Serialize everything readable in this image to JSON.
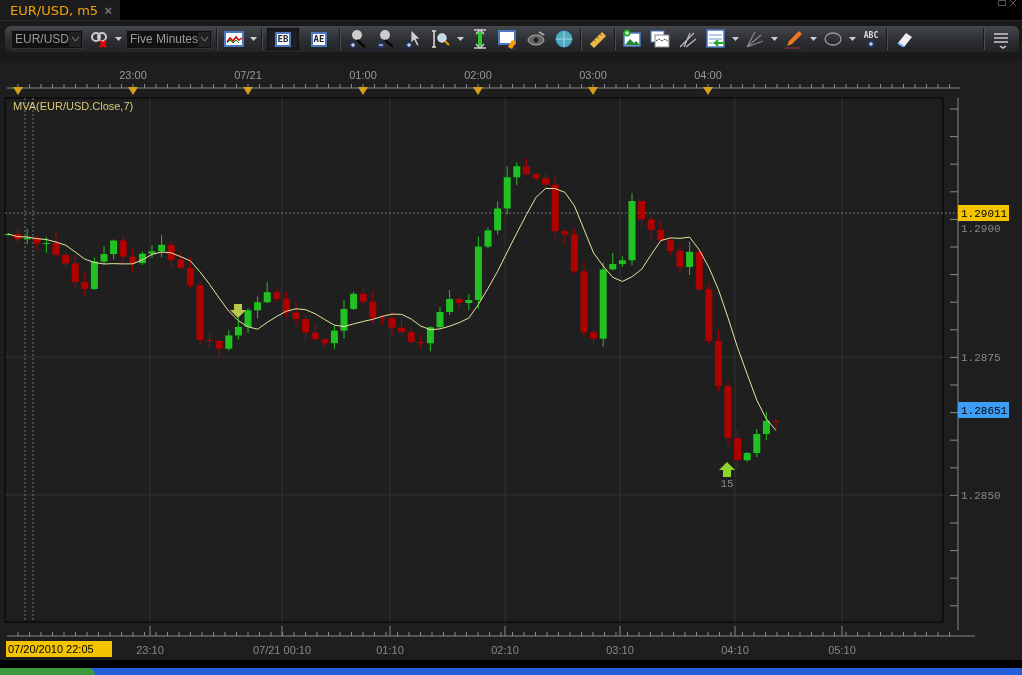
{
  "tab": {
    "title": "EUR/USD, m5",
    "close": "×",
    "active": true
  },
  "toolbar": {
    "symbol": "EUR/USD",
    "timeframe": "Five Minutes",
    "view_toggles": [
      {
        "label": "EB",
        "selected": true
      },
      {
        "label": "AE",
        "selected": false
      }
    ],
    "text_tool_label": "ABC"
  },
  "chart": {
    "indicator_label": "MVA(EUR/USD.Close,7)",
    "top_time_labels": [
      "23:00",
      "07/21",
      "01:00",
      "02:00",
      "03:00",
      "04:00"
    ],
    "bottom_time_labels": [
      "23:10",
      "07/21 00:10",
      "01:10",
      "02:10",
      "03:10",
      "04:10",
      "05:10"
    ],
    "cursor_time": "07/20/2010 22:05",
    "price_labels": [
      "1.2900",
      "1.2875",
      "1.2850"
    ],
    "bid_tag": "1.29011",
    "ask_tag": "1.28651",
    "signal_count": "15"
  }
}
